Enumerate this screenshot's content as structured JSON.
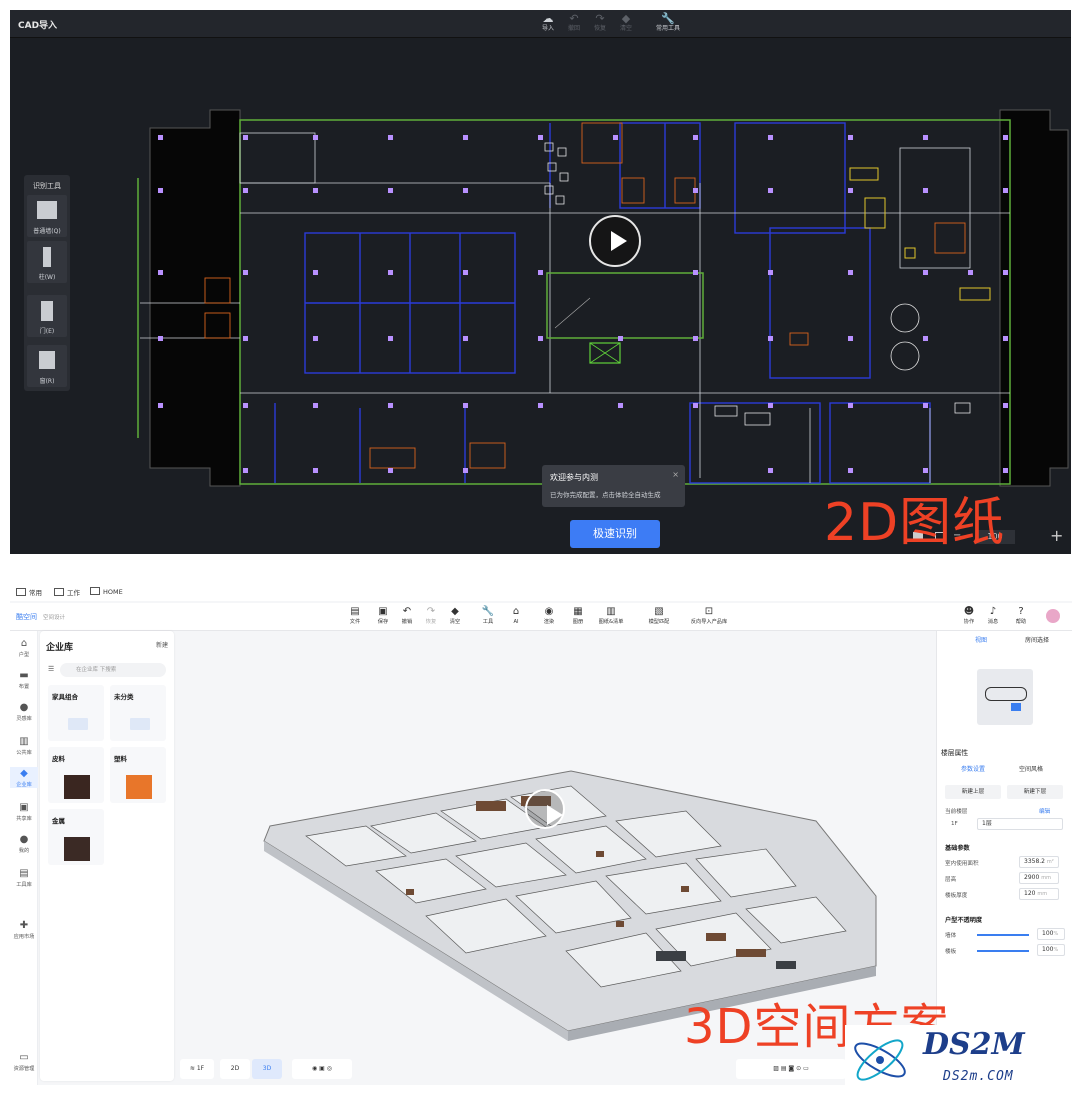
{
  "top_panel": {
    "title": "CAD导入",
    "toolbar": [
      {
        "icon": "cloud-upload-icon",
        "label": "导入",
        "enabled": true
      },
      {
        "icon": "undo-icon",
        "label": "撤回",
        "enabled": false
      },
      {
        "icon": "redo-icon",
        "label": "恢复",
        "enabled": false
      },
      {
        "icon": "clear-icon",
        "label": "清空",
        "enabled": false
      },
      {
        "icon": "wrench-icon",
        "label": "常用工具",
        "enabled": true
      }
    ],
    "recognize_tools": {
      "heading": "识别工具",
      "items": [
        {
          "icon": "wall-icon",
          "label": "普通墙(Q)"
        },
        {
          "icon": "column-icon",
          "label": "柱(W)"
        },
        {
          "icon": "door-icon",
          "label": "门(E)"
        },
        {
          "icon": "window-icon",
          "label": "窗(R)"
        }
      ]
    },
    "popup": {
      "title": "欢迎参与内测",
      "body": "已为你完成配置，点击体验全自动生成",
      "close": "×"
    },
    "recognize_button": "极速识别",
    "zoom_value": "100",
    "caption": "2D图纸"
  },
  "bottom_panel": {
    "tabs": [
      "常用",
      "工作",
      "HOME"
    ],
    "brand": "酷空间",
    "brand_tag": "空间设计",
    "header_tools": [
      {
        "icon": "file-icon",
        "label": "文件"
      },
      {
        "icon": "save-icon",
        "label": "保存"
      },
      {
        "icon": "undo-icon",
        "label": "撤销"
      },
      {
        "icon": "redo-icon",
        "label": "恢复"
      },
      {
        "icon": "clear-icon",
        "label": "清空"
      },
      {
        "icon": "wrench-icon",
        "label": "工具"
      },
      {
        "icon": "ai-icon",
        "label": "AI"
      },
      {
        "icon": "render-icon",
        "label": "渲染"
      },
      {
        "icon": "drawing-icon",
        "label": "图册"
      },
      {
        "icon": "list-icon",
        "label": "图纸&清单"
      },
      {
        "icon": "model-icon",
        "label": "模型匹配"
      },
      {
        "icon": "import-icon",
        "label": "反向导入产品库"
      }
    ],
    "right_header": [
      {
        "icon": "collab-icon",
        "label": "协作"
      },
      {
        "icon": "bell-icon",
        "label": "消息"
      },
      {
        "icon": "help-icon",
        "label": "帮助"
      }
    ],
    "left_nav": [
      {
        "icon": "house-icon",
        "label": "户型"
      },
      {
        "icon": "sofa-icon",
        "label": "布置"
      },
      {
        "icon": "bulb-icon",
        "label": "灵感库"
      },
      {
        "icon": "building-icon",
        "label": "公共库"
      },
      {
        "icon": "diamond-icon",
        "label": "企业库"
      },
      {
        "icon": "share-icon",
        "label": "共享库"
      },
      {
        "icon": "user-icon",
        "label": "我的"
      },
      {
        "icon": "toolbox-icon",
        "label": "工具库"
      },
      {
        "icon": "puzzle-icon",
        "label": "应用市场"
      },
      {
        "icon": "folder-icon",
        "label": "资源管理"
      }
    ],
    "library": {
      "title": "企业库",
      "new_folder": "新建",
      "search_placeholder": "在企业库 下搜索",
      "cards": [
        {
          "name": "家具组合",
          "kind": "folder"
        },
        {
          "name": "未分类",
          "kind": "folder"
        },
        {
          "name": "皮料",
          "color": "#3a2620"
        },
        {
          "name": "塑料",
          "color": "#e8762a"
        },
        {
          "name": "金属",
          "color": "#3b2a25"
        }
      ]
    },
    "right_panel": {
      "tabs": [
        "视图",
        "房间选择"
      ],
      "floor_props": "楼层属性",
      "sub_tabs": [
        "参数设置",
        "空间风格"
      ],
      "btn_up": "新建上层",
      "btn_down": "新建下层",
      "current_floor_label": "当前楼层",
      "edit": "编辑",
      "floor_prefix": "1F",
      "floor_value": "1层",
      "basic_params": "基础参数",
      "params": [
        {
          "label": "室内使用面积",
          "value": "3358.2",
          "unit": "m²"
        },
        {
          "label": "层高",
          "value": "2900",
          "unit": "mm"
        },
        {
          "label": "楼板厚度",
          "value": "120",
          "unit": "mm"
        }
      ],
      "opacity_title": "户型不透明度",
      "opacity": [
        {
          "label": "墙体",
          "value": "100",
          "unit": "%",
          "level": 1.0
        },
        {
          "label": "楼板",
          "value": "100",
          "unit": "%",
          "level": 1.0
        }
      ]
    },
    "bottom_bar": {
      "floor": "1F",
      "mode_2d": "2D",
      "mode_3d": "3D"
    },
    "caption": "3D空间方案"
  },
  "watermark": {
    "name": "DS2M",
    "url": "DS2m.COM"
  }
}
